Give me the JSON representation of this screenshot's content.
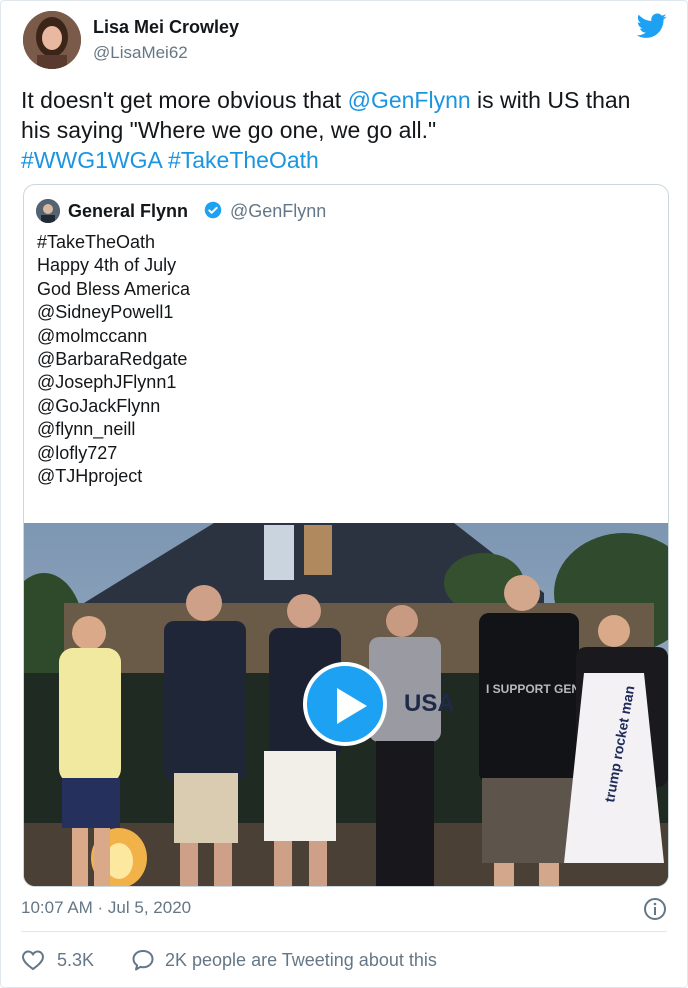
{
  "tweet": {
    "author_name": "Lisa Mei Crowley",
    "author_handle": "@LisaMei62",
    "text_before": "It doesn't get more obvious that ",
    "mention": "@GenFlynn",
    "text_after": " is with US than his saying \"Where we go one, we go all.\"",
    "hashtag1": "#WWG1WGA",
    "hashtag2": "#TakeTheOath",
    "timestamp": "10:07 AM · Jul 5, 2020",
    "likes": "5.3K",
    "tweeting": "2K people are Tweeting about this"
  },
  "quoted": {
    "name": "General Flynn",
    "handle": "@GenFlynn",
    "lines": [
      "#TakeTheOath",
      "Happy 4th of July",
      "God Bless America",
      "@SidneyPowell1",
      "@molmccann",
      "@BarbaraRedgate",
      "@JosephJFlynn1",
      "@GoJackFlynn",
      "@flynn_neill",
      "@lofly727",
      "@TJHproject"
    ]
  },
  "media": {
    "play_icon": "play-icon",
    "shirt_text": "USA",
    "shirt_text2": "I SUPPORT GENERAL FLYNN",
    "dress_text": "trump rocket man"
  },
  "colors": {
    "accent": "#1da1f2",
    "link": "#1b95e0",
    "muted": "#657786",
    "border": "#e1e8ed"
  },
  "icons": [
    "twitter-bird-icon",
    "verified-badge-icon",
    "play-icon",
    "info-icon",
    "heart-icon",
    "speech-bubble-icon"
  ]
}
